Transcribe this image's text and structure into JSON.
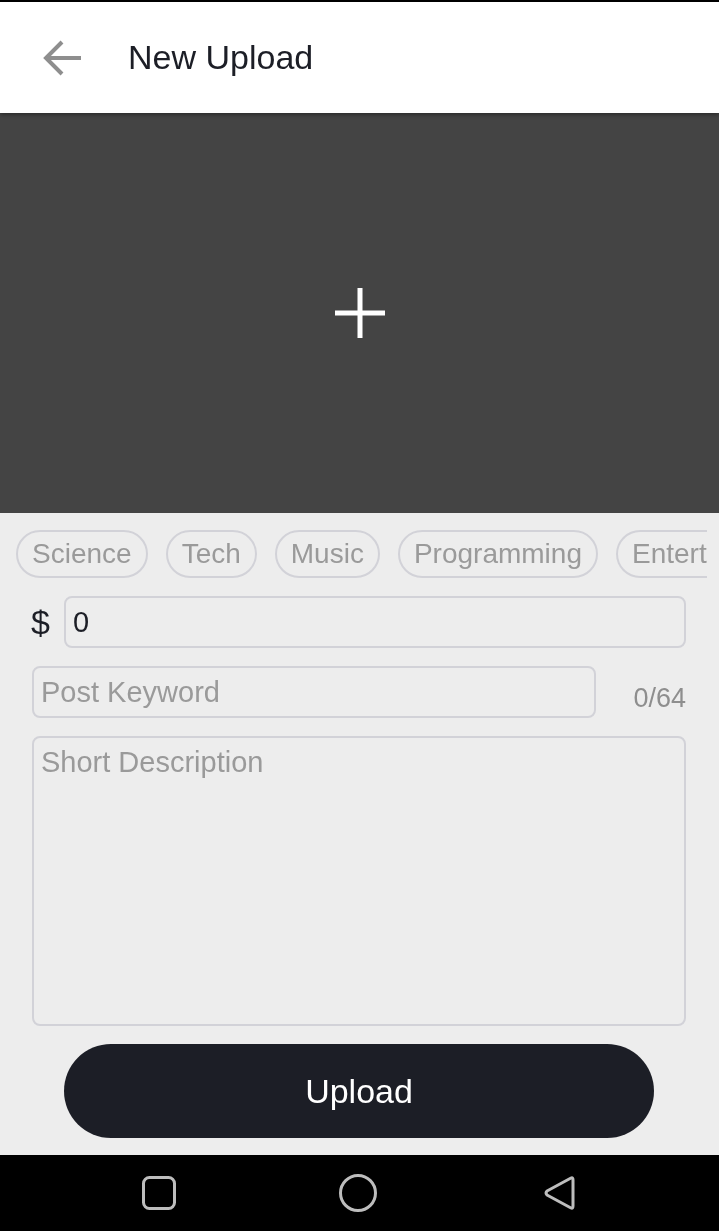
{
  "app_bar": {
    "title": "New Upload"
  },
  "categories": [
    {
      "label": "Science"
    },
    {
      "label": "Tech"
    },
    {
      "label": "Music"
    },
    {
      "label": "Programming"
    },
    {
      "label": "Entert"
    }
  ],
  "price": {
    "currency": "$",
    "value": "0"
  },
  "keyword": {
    "placeholder": "Post Keyword",
    "counter": "0/64"
  },
  "description": {
    "placeholder": "Short Description"
  },
  "upload_button": {
    "label": "Upload"
  }
}
